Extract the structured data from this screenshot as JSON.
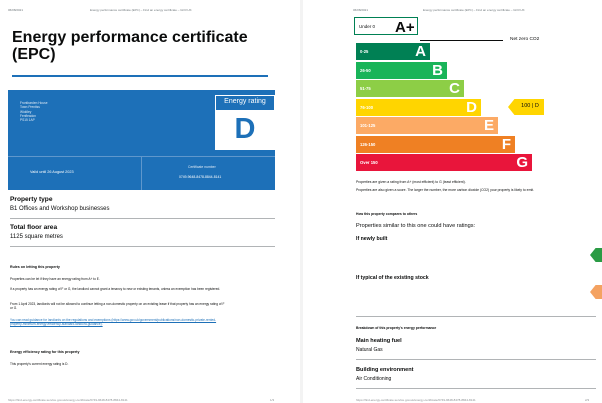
{
  "page1": {
    "header_date": "06/08/2021",
    "header_title": "Energy performance certificate (EPC) – Find an energy certificate – GOV.UK",
    "title": "Energy performance certificate (EPC)",
    "address": [
      "Frontbarden House",
      "Town Prentiss",
      "Widdley",
      "Fenfleadon",
      "PS15 1AP"
    ],
    "rating_label": "Energy rating",
    "rating": "D",
    "valid_until": "Valid until 26 August 2023",
    "certificate_label": "Certificate number",
    "certificate_number": "0749-9648-8478-8844-8141",
    "property_type_label": "Property type",
    "property_type": "B1 Offices and Workshop businesses",
    "floor_area_label": "Total floor area",
    "floor_area": "1125 square metres",
    "rules_heading": "Rules on letting this property",
    "rules_p1": "Properties can be let if they have an energy rating from A+ to E.",
    "rules_p2": "If a property has an energy rating of F or G, the landlord cannot grant a tenancy to new or existing tenants, unless an exemption has been registered.",
    "rules_p3": "From 1 April 2023, landlords will not be allowed to continue letting a non-domestic property on an existing lease if that property has an energy rating of F or G.",
    "rules_link": "You can read guidance for landlords on the regulations and exemptions (https://www.gov.uk/government/publications/non-domestic-private-rented-property-minimum-energy-efficiency-standard-landlord-guidance).",
    "efficiency_heading": "Energy efficiency rating for this property",
    "efficiency_text": "This property's current energy rating is D.",
    "footer_url": "https://find-energy-certificate.service.gov.uk/energy-certificate/0749-9648-8478-8844-8141",
    "footer_page": "1/3"
  },
  "page2": {
    "header_date": "06/08/2021",
    "header_title": "Energy performance certificate (EPC) – Find an energy certificate – GOV.UK",
    "under_label": "Under 0",
    "under_letter": "A+",
    "net_zero": "Net zero CO2",
    "pointer": "100 | D",
    "caption1": "Properties are given a rating from A+ (most efficient) to G (least efficient).",
    "caption2": "Properties are also given a score. The larger the number, the more carbon dioxide (CO2) your property is likely to emit.",
    "compare_heading": "How this property compares to others",
    "compare_text": "Properties similar to this one could have ratings:",
    "newly_built": "If newly built",
    "typical_stock": "If typical of the existing stock",
    "breakdown_heading": "Breakdown of this property's energy performance",
    "heating_label": "Main heating fuel",
    "heating_value": "Natural Gas",
    "env_label": "Building environment",
    "env_value": "Air Conditioning",
    "footer_url": "https://find-energy-certificate.service.gov.uk/energy-certificate/0749-9648-8478-8844-8141",
    "footer_page": "2/3"
  },
  "chart_data": {
    "type": "bar",
    "categories": [
      "A",
      "B",
      "C",
      "D",
      "E",
      "F",
      "G"
    ],
    "ranges": [
      "0-25",
      "26-50",
      "51-75",
      "76-100",
      "101-125",
      "126-150",
      "Over 150"
    ],
    "colors": [
      "#008054",
      "#19b459",
      "#8dce46",
      "#ffd500",
      "#fcaa65",
      "#ef8023",
      "#e9153b"
    ],
    "current_score": 100,
    "current_rating": "D"
  }
}
